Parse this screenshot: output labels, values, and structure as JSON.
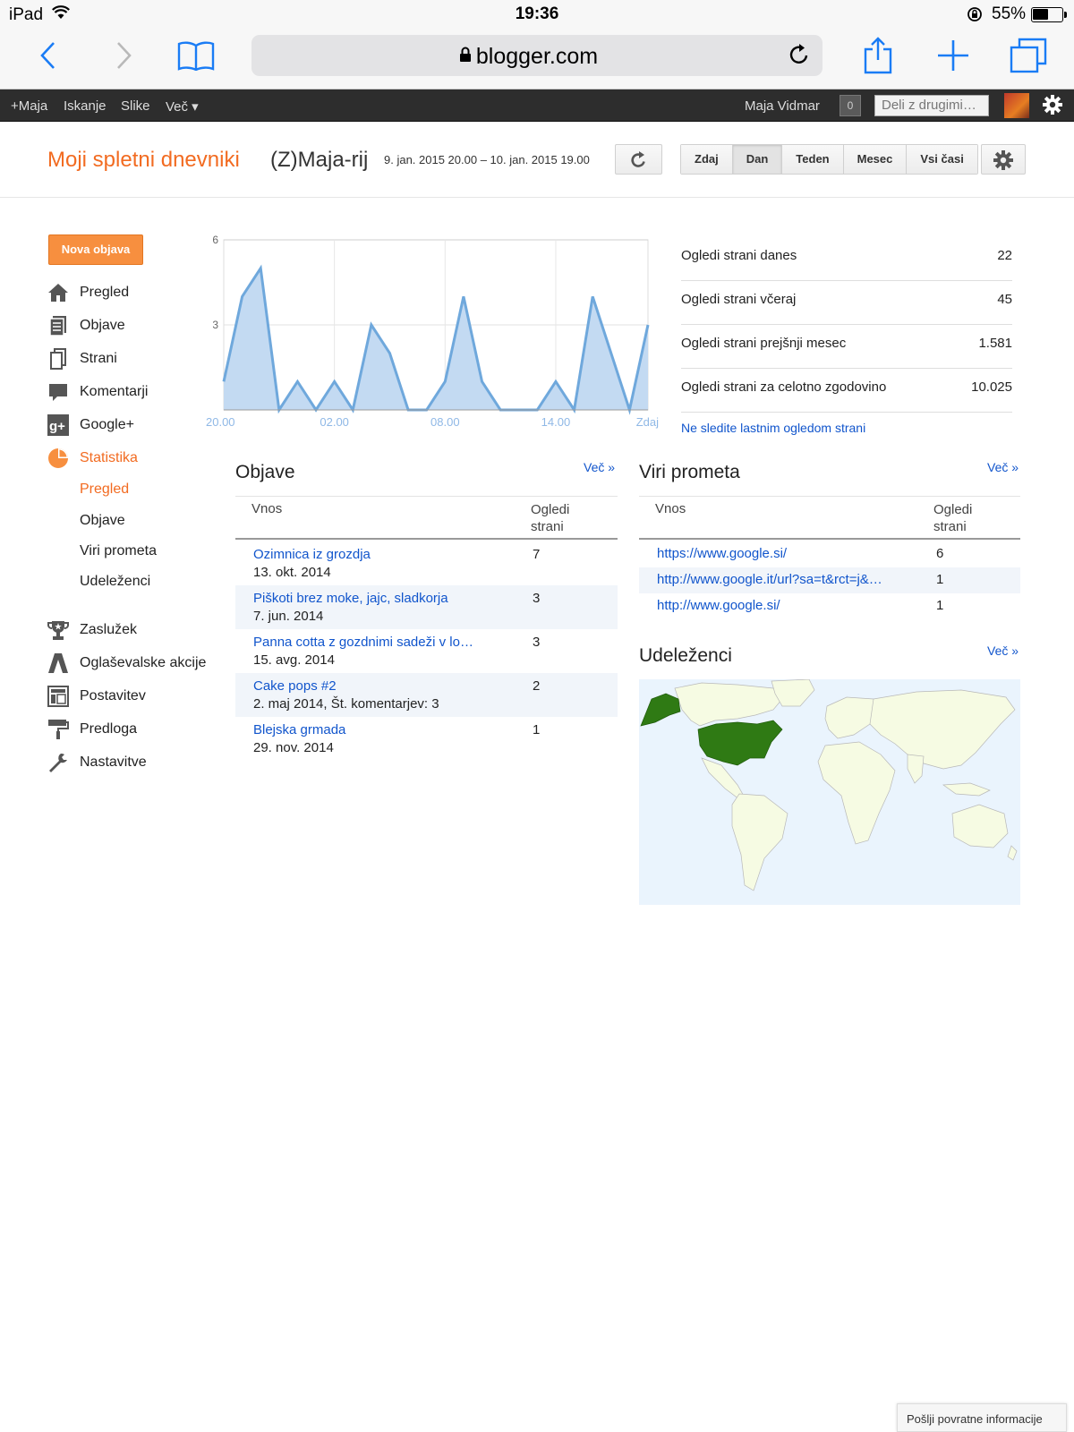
{
  "status_bar": {
    "device": "iPad",
    "time": "19:36",
    "battery": "55%",
    "battery_level": 0.55
  },
  "browser": {
    "url": "blogger.com"
  },
  "google_bar": {
    "links": [
      "+Maja",
      "Iskanje",
      "Slike",
      "Več ▾"
    ],
    "user_name": "Maja Vidmar",
    "notifications": "0",
    "share_placeholder": "Deli z drugimi…"
  },
  "header": {
    "my_blogs": "Moji spletni dnevniki",
    "blog_name": "(Z)Maja-rij",
    "date_range": "9. jan. 2015 20.00 – 10. jan. 2015 19.00",
    "range_tabs": [
      "Zdaj",
      "Dan",
      "Teden",
      "Mesec",
      "Vsi časi"
    ],
    "active_tab": "Dan"
  },
  "sidebar": {
    "new_post": "Nova objava",
    "items": [
      {
        "label": "Pregled",
        "icon": "home-icon"
      },
      {
        "label": "Objave",
        "icon": "posts-icon"
      },
      {
        "label": "Strani",
        "icon": "pages-icon"
      },
      {
        "label": "Komentarji",
        "icon": "comments-icon"
      },
      {
        "label": "Google+",
        "icon": "google-plus-icon"
      },
      {
        "label": "Statistika",
        "icon": "stats-pie-icon"
      }
    ],
    "stats_sub": [
      "Pregled",
      "Objave",
      "Viri prometa",
      "Udeleženci"
    ],
    "items2": [
      {
        "label": "Zaslužek",
        "icon": "trophy-icon"
      },
      {
        "label": "Oglaševalske akcije",
        "icon": "campaigns-icon"
      },
      {
        "label": "Postavitev",
        "icon": "layout-icon"
      },
      {
        "label": "Predloga",
        "icon": "template-roller-icon"
      },
      {
        "label": "Nastavitve",
        "icon": "wrench-icon"
      }
    ]
  },
  "chart_data": {
    "type": "area",
    "x_ticks": [
      "20.00",
      "02.00",
      "08.00",
      "14.00",
      "Zdaj"
    ],
    "y_ticks": [
      "6",
      "3"
    ],
    "ylim": [
      0,
      6
    ],
    "values": [
      1,
      4,
      5,
      0,
      1,
      0,
      1,
      0,
      3,
      2,
      0,
      0,
      1,
      4,
      1,
      0,
      0,
      0,
      1,
      0,
      4,
      2,
      0,
      3
    ],
    "color": "#6fa8dc",
    "fill": "#c3daf2"
  },
  "summary": {
    "rows": [
      {
        "label": "Ogledi strani danes",
        "value": "22"
      },
      {
        "label": "Ogledi strani včeraj",
        "value": "45"
      },
      {
        "label": "Ogledi strani prejšnji mesec",
        "value": "1.581"
      },
      {
        "label": "Ogledi strani za celotno zgodovino",
        "value": "10.025"
      }
    ],
    "not_tracking": "Ne sledite lastnim ogledom strani"
  },
  "posts_panel": {
    "title": "Objave",
    "more": "Več »",
    "col1": "Vnos",
    "col2a": "Ogledi",
    "col2b": "strani",
    "rows": [
      {
        "title": "Ozimnica iz grozdja",
        "meta": "13. okt. 2014",
        "views": "7"
      },
      {
        "title": "Piškoti brez moke, jajc, sladkorja",
        "meta": "7. jun. 2014",
        "views": "3"
      },
      {
        "title": "Panna cotta z gozdnimi sadeži v lo…",
        "meta": "15. avg. 2014",
        "views": "3"
      },
      {
        "title": "Cake pops #2",
        "meta": "2. maj 2014, Št. komentarjev: 3",
        "views": "2"
      },
      {
        "title": "Blejska grmada",
        "meta": "29. nov. 2014",
        "views": "1"
      }
    ]
  },
  "sources_panel": {
    "title": "Viri prometa",
    "more": "Več »",
    "col1": "Vnos",
    "col2a": "Ogledi",
    "col2b": "strani",
    "rows": [
      {
        "title": "https://www.google.si/",
        "views": "6"
      },
      {
        "title": "http://www.google.it/url?sa=t&rct=j&…",
        "views": "1"
      },
      {
        "title": "http://www.google.si/",
        "views": "1"
      }
    ]
  },
  "audience_panel": {
    "title": "Udeleženci",
    "more": "Več »"
  },
  "feedback": "Pošlji povratne informacije"
}
